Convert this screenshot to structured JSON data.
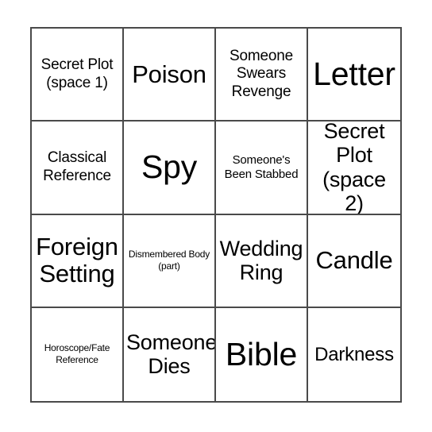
{
  "card": {
    "name": "bingo-card",
    "columns": 4,
    "rows": 4,
    "border_color": "#4a4a4a",
    "background_color": "#ffffff",
    "text_color": "#000000",
    "cells": [
      {
        "label": "Secret Plot (space 1)",
        "size": "md"
      },
      {
        "label": "Poison",
        "size": "xxl"
      },
      {
        "label": "Someone Swears Revenge",
        "size": "md"
      },
      {
        "label": "Letter",
        "size": "jumbo"
      },
      {
        "label": "Classical Reference",
        "size": "md"
      },
      {
        "label": "Spy",
        "size": "jumbo"
      },
      {
        "label": "Someone's Been Stabbed",
        "size": "sm"
      },
      {
        "label": "Secret Plot (space 2)",
        "size": "xl"
      },
      {
        "label": "Foreign Setting",
        "size": "xxl"
      },
      {
        "label": "Dismembered Body (part)",
        "size": "xs"
      },
      {
        "label": "Wedding Ring",
        "size": "xl"
      },
      {
        "label": "Candle",
        "size": "xxl"
      },
      {
        "label": "Horoscope/Fate Reference",
        "size": "xs"
      },
      {
        "label": "Someone Dies",
        "size": "xl"
      },
      {
        "label": "Bible",
        "size": "jumbo"
      },
      {
        "label": "Darkness",
        "size": "lg"
      }
    ]
  }
}
